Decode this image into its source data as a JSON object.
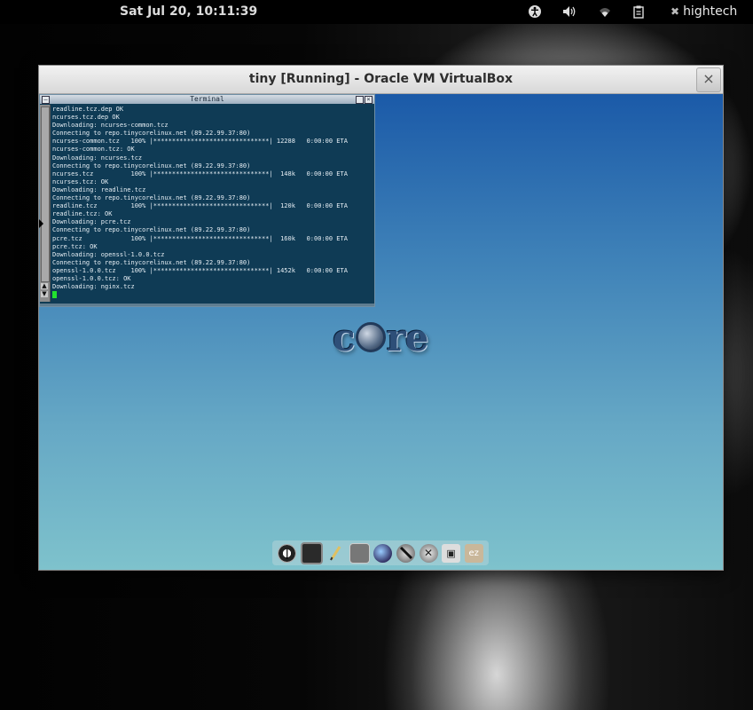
{
  "topbar": {
    "clock": "Sat Jul 20, 10:11:39",
    "icons": [
      "accessibility-icon",
      "volume-icon",
      "wifi-icon",
      "clipboard-icon",
      "user-icon"
    ],
    "user": "hightech"
  },
  "vbox": {
    "title": "tiny [Running] - Oracle VM VirtualBox",
    "close_label": "×"
  },
  "terminal": {
    "title": "Terminal",
    "lines": [
      "readline.tcz.dep OK",
      "ncurses.tcz.dep OK",
      "Downloading: ncurses-common.tcz",
      "Connecting to repo.tinycorelinux.net (89.22.99.37:80)",
      "ncurses-common.tcz   100% |*******************************| 12288   0:00:00 ETA",
      "ncurses-common.tcz: OK",
      "Downloading: ncurses.tcz",
      "Connecting to repo.tinycorelinux.net (89.22.99.37:80)",
      "ncurses.tcz          100% |*******************************|  148k   0:00:00 ETA",
      "ncurses.tcz: OK",
      "Downloading: readline.tcz",
      "Connecting to repo.tinycorelinux.net (89.22.99.37:80)",
      "readline.tcz         100% |*******************************|  120k   0:00:00 ETA",
      "readline.tcz: OK",
      "Downloading: pcre.tcz",
      "Connecting to repo.tinycorelinux.net (89.22.99.37:80)",
      "pcre.tcz             100% |*******************************|  160k   0:00:00 ETA",
      "pcre.tcz: OK",
      "Downloading: openssl-1.0.0.tcz",
      "Connecting to repo.tinycorelinux.net (89.22.99.37:80)",
      "openssl-1.0.0.tcz    100% |*******************************| 1452k   0:00:00 ETA",
      "openssl-1.0.0.tcz: OK",
      "Downloading: nginx.tcz"
    ]
  },
  "guest": {
    "logo_text_left": "c",
    "logo_text_right": "re",
    "dock_icons": [
      "power-icon",
      "terminal-icon",
      "editor-icon",
      "control-panel-icon",
      "apps-browser-icon",
      "tools-icon",
      "settings-icon",
      "mount-icon",
      "ezremaster-icon"
    ]
  }
}
